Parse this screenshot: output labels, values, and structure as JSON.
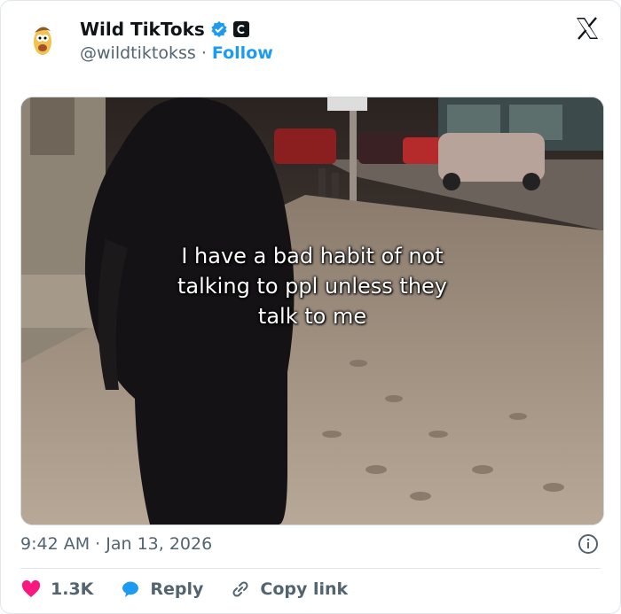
{
  "author": {
    "name": "Wild TikToks",
    "handle": "@wildtiktokss",
    "separator": "·",
    "follow_label": "Follow"
  },
  "media": {
    "caption_lines": [
      "I have a bad habit of not",
      "talking to ppl unless they",
      "talk to me"
    ]
  },
  "meta": {
    "time": "9:42 AM",
    "separator": "·",
    "date": "Jan 13, 2026"
  },
  "actions": {
    "likes": "1.3K",
    "reply_label": "Reply",
    "copy_label": "Copy link"
  },
  "colors": {
    "accent": "#1d9bf0",
    "like": "#f91880",
    "muted": "#536471"
  }
}
